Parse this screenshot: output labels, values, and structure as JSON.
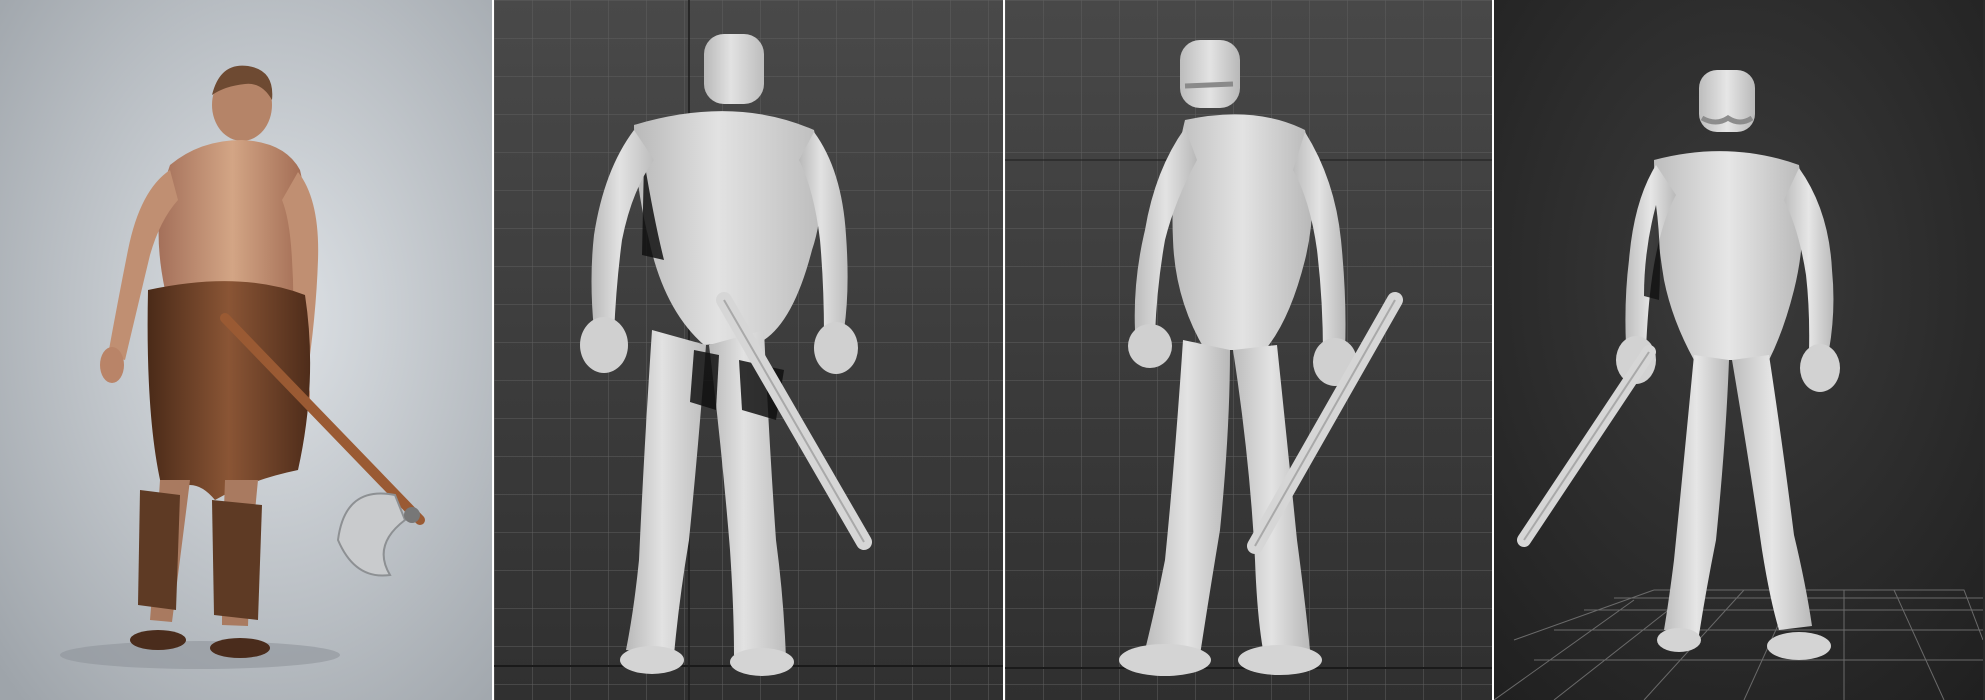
{
  "panels": [
    {
      "view": "photo-reference-back",
      "background": "#c9ced3"
    },
    {
      "view": "viewport-back",
      "background": "#3c3c3c",
      "grid": true
    },
    {
      "view": "viewport-three-quarter",
      "background": "#3c3c3c",
      "grid": true
    },
    {
      "view": "viewport-front-perspective",
      "background": "#2b2b2b",
      "grid": true
    }
  ],
  "colors": {
    "model": "#d7d7d7",
    "model_shadow": "#a9a9a9",
    "grid_line": "#5a5a5a",
    "skin": "#c99a7a",
    "leather": "#7a4a2c"
  },
  "icons": [
    "axe-icon",
    "staff-icon",
    "sunglasses-icon"
  ]
}
